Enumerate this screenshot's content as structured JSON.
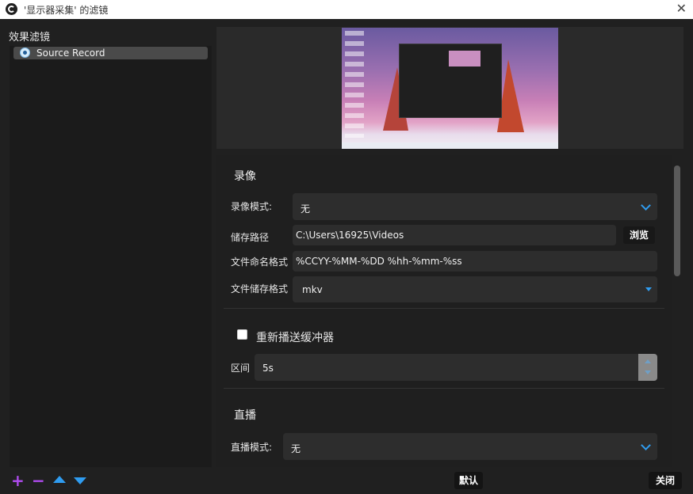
{
  "window": {
    "title": "'显示器采集' 的滤镜",
    "close_glyph": "✕"
  },
  "filters_panel": {
    "title": "效果滤镜",
    "items": [
      {
        "label": "Source Record"
      }
    ],
    "controls": {
      "add": "+",
      "remove": "−"
    }
  },
  "recording": {
    "section_title": "录像",
    "mode_label": "录像模式:",
    "mode_value": "无",
    "path_label": "储存路径",
    "path_value": "C:\\Users\\16925\\Videos",
    "browse_button": "浏览",
    "naming_label": "文件命名格式",
    "naming_value": "%CCYY-%MM-%DD %hh-%mm-%ss",
    "format_label": "文件储存格式",
    "format_value": "mkv"
  },
  "replay": {
    "checkbox_label": "重新播送缓冲器",
    "checked": false,
    "interval_label": "区间",
    "interval_value": "5s"
  },
  "streaming": {
    "section_title": "直播",
    "mode_label": "直播模式:",
    "mode_value": "无"
  },
  "footer": {
    "defaults_button": "默认",
    "close_button": "关闭"
  },
  "colors": {
    "accent_blue": "#2f9cf0",
    "accent_purple": "#b04cf0",
    "background": "#202020"
  }
}
